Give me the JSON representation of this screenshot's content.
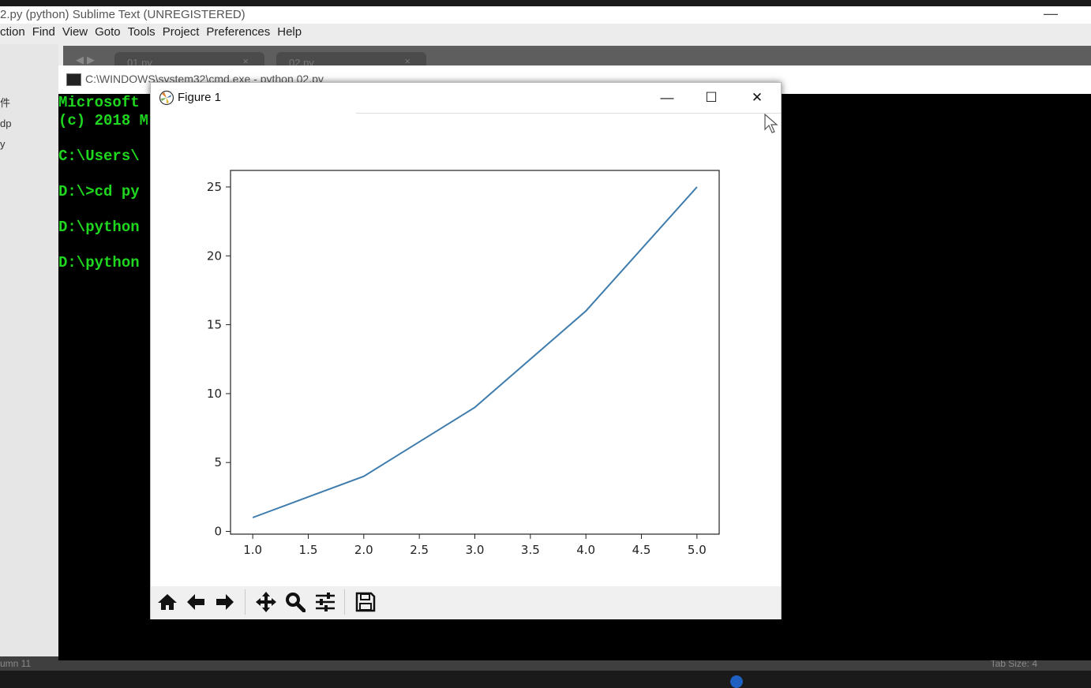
{
  "sublime": {
    "title": "2.py (python)    Sublime Text (UNREGISTERED)",
    "menu": [
      "ction",
      "Find",
      "View",
      "Goto",
      "Tools",
      "Project",
      "Preferences",
      "Help"
    ],
    "tabs": [
      {
        "label": "01.py",
        "close": "×"
      },
      {
        "label": "02.py",
        "close": "×"
      }
    ],
    "sidebar_items": [
      "件",
      "dp",
      "y"
    ],
    "status_left": "umn 11",
    "status_right": "Tab Size: 4",
    "minimize_glyph": "—"
  },
  "cmd": {
    "title": "C:\\WINDOWS\\system32\\cmd.exe - python  02.py",
    "lines": [
      "Microsoft",
      "(c) 2018 M",
      "",
      "C:\\Users\\",
      "",
      "D:\\>cd py",
      "",
      "D:\\python",
      "",
      "D:\\python"
    ]
  },
  "figure": {
    "title": "Figure 1",
    "controls": {
      "minimize": "—",
      "maximize": "☐",
      "close": "✕"
    },
    "toolbar": [
      {
        "name": "home-icon",
        "tip": "Home"
      },
      {
        "name": "back-arrow-icon",
        "tip": "Back"
      },
      {
        "name": "forward-arrow-icon",
        "tip": "Forward"
      },
      {
        "name": "pan-move-icon",
        "tip": "Pan"
      },
      {
        "name": "zoom-magnifier-icon",
        "tip": "Zoom"
      },
      {
        "name": "configure-subplots-icon",
        "tip": "Subplots"
      },
      {
        "name": "save-floppy-icon",
        "tip": "Save"
      }
    ]
  },
  "chart_data": {
    "type": "line",
    "x": [
      1.0,
      2.0,
      3.0,
      4.0,
      5.0
    ],
    "series": [
      {
        "values": [
          1,
          4,
          9,
          16,
          25
        ],
        "color": "#3e7cad"
      }
    ],
    "xticks": [
      "1.0",
      "1.5",
      "2.0",
      "2.5",
      "3.0",
      "3.5",
      "4.0",
      "4.5",
      "5.0"
    ],
    "yticks": [
      "0",
      "5",
      "10",
      "15",
      "20",
      "25"
    ],
    "xlim": [
      0.8,
      5.2
    ],
    "ylim": [
      -0.2,
      26.2
    ],
    "title": "",
    "xlabel": "",
    "ylabel": "",
    "grid": false
  }
}
